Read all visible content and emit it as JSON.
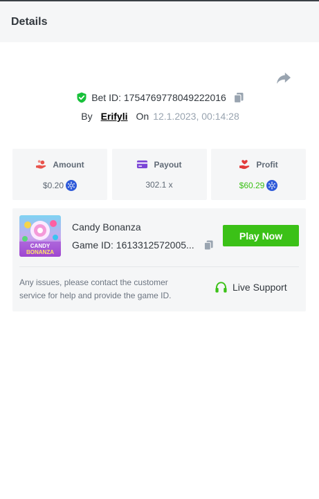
{
  "header": {
    "title": "Details"
  },
  "bet": {
    "id_label": "Bet ID: 1754769778049222016",
    "by_label": "By",
    "user": "Erifyli",
    "on_label": "On",
    "date": "12.1.2023, 00:14:28"
  },
  "stats": {
    "amount": {
      "label": "Amount",
      "value": "$0.20"
    },
    "payout": {
      "label": "Payout",
      "value": "302.1 x"
    },
    "profit": {
      "label": "Profit",
      "value": "$60.29"
    }
  },
  "game": {
    "name": "Candy Bonanza",
    "id_label": "Game ID: 1613312572005...",
    "thumb_text_line1": "CANDY",
    "thumb_text_line2": "BONANZA",
    "play_label": "Play Now"
  },
  "support": {
    "notice": "Any issues, please contact the customer service for help and provide the game ID.",
    "label": "Live Support"
  },
  "icons": {
    "share": "share-arrow-icon",
    "verified": "shield-check-icon",
    "copy": "copy-icon",
    "amount": "hand-coins-icon",
    "payout": "card-icon",
    "profit": "hand-heart-icon",
    "coin": "cardano-coin-icon",
    "support": "headset-icon"
  },
  "colors": {
    "accent_green": "#3bc117",
    "amount_icon": "#e8534c",
    "payout_icon": "#7b45d6",
    "profit_icon": "#e23b3b",
    "coin_blue": "#2f5bd9"
  }
}
